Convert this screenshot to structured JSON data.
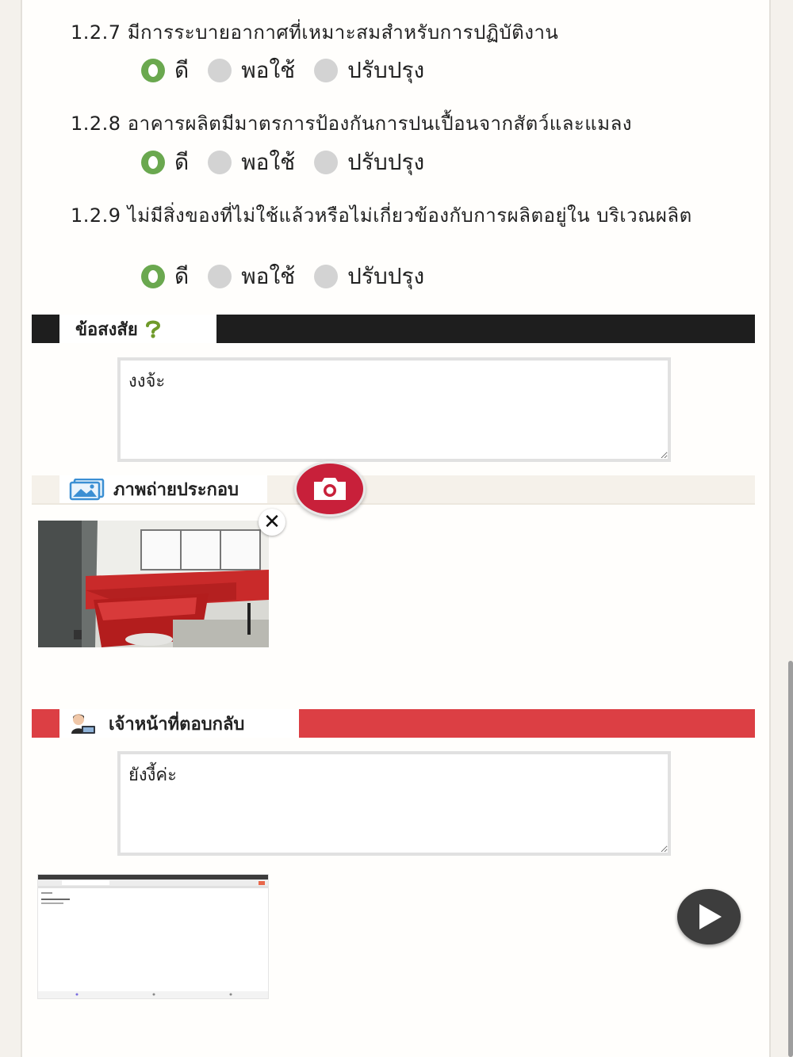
{
  "questions": [
    {
      "text": "1.2.7 มีการระบายอากาศที่เหมาะสมสำหรับการปฏิบัติงาน"
    },
    {
      "text": "1.2.8 อาคารผลิตมีมาตรการป้องกันการปนเปื้อนจากสัตว์และแมลง"
    },
    {
      "text": "1.2.9 ไม่มีสิ่งของที่ไม่ใช้แล้วหรือไม่เกี่ยวข้องกับการผลิตอยู่ใน บริเวณผลิต"
    }
  ],
  "options": {
    "good": "ดี",
    "fair": "พอใช้",
    "improve": "ปรับปรุง"
  },
  "selected_option": "good",
  "doubts": {
    "title": "ข้อสงสัย",
    "value": "งงจ้ะ",
    "icon": "question-icon",
    "bar_color": "#1e1e1e"
  },
  "photos": {
    "title": "ภาพถ่ายประกอบ",
    "icon": "image-icon",
    "camera_icon": "camera-icon",
    "close_icon": "close-icon"
  },
  "staff_reply": {
    "title": "เจ้าหน้าที่ตอบกลับ",
    "value": "ยังงี้ค่ะ",
    "icon": "staff-avatar-icon",
    "bar_color": "#dc3f44"
  },
  "reply_attachment": {
    "play_icon": "play-icon"
  },
  "colors": {
    "accent_green": "#6aa84f",
    "camera_red": "#c8203a"
  }
}
